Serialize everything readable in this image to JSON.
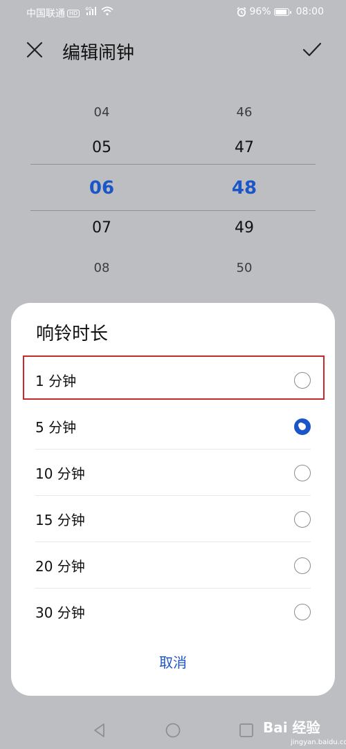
{
  "status_bar": {
    "carrier": "中国联通",
    "hd": "HD",
    "network": "4G",
    "battery": "96%",
    "battery_level": 0.96,
    "time": "08:00"
  },
  "header": {
    "title": "编辑闹钟"
  },
  "time_picker": {
    "hours": [
      "04",
      "05",
      "06",
      "07",
      "08"
    ],
    "minutes": [
      "46",
      "47",
      "48",
      "49",
      "50"
    ],
    "selected_hour": "06",
    "selected_minute": "48"
  },
  "sheet": {
    "title": "响铃时长",
    "options": [
      {
        "label": "1 分钟",
        "selected": false
      },
      {
        "label": "5 分钟",
        "selected": true
      },
      {
        "label": "10 分钟",
        "selected": false
      },
      {
        "label": "15 分钟",
        "selected": false
      },
      {
        "label": "20 分钟",
        "selected": false
      },
      {
        "label": "30 分钟",
        "selected": false
      }
    ],
    "cancel_label": "取消"
  },
  "watermark": {
    "brand": "Bai 经验",
    "url": "jingyan.baidu.com"
  },
  "colors": {
    "accent": "#1a56c7",
    "highlight": "#c6292a",
    "backdrop": "#bdbec2"
  }
}
